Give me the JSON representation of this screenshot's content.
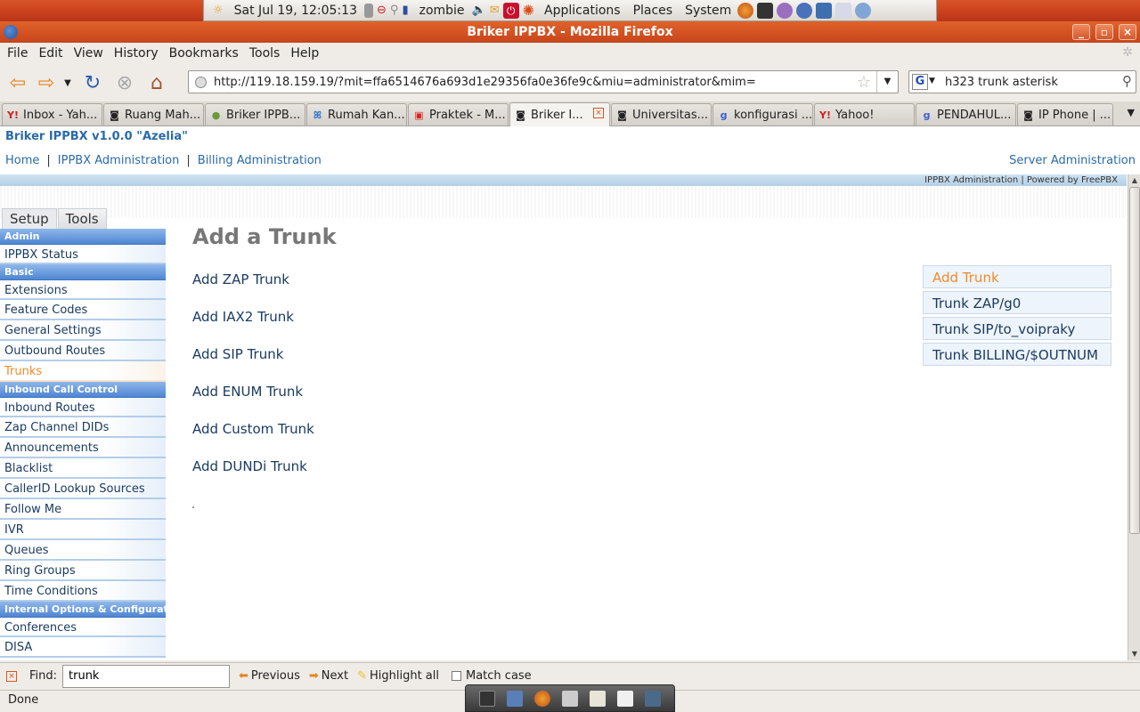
{
  "gnome_panel": {
    "clock": "Sat Jul 19, 12:05:13",
    "user": "zombie",
    "menus": [
      "Applications",
      "Places",
      "System"
    ]
  },
  "window": {
    "title": "Briker IPPBX - Mozilla Firefox"
  },
  "menubar": [
    "File",
    "Edit",
    "View",
    "History",
    "Bookmarks",
    "Tools",
    "Help"
  ],
  "navigation": {
    "url": "http://119.18.159.19/?mit=ffa6514676a693d1e29356fa0e36fe9c&miu=administrator&mim=",
    "search_query": "h323 trunk asterisk"
  },
  "tabs": [
    {
      "label": "Inbox - Yah...",
      "icon": "yahoo-icon"
    },
    {
      "label": "Ruang Mah...",
      "icon": "page-icon"
    },
    {
      "label": "Briker IPPB...",
      "icon": "page-icon"
    },
    {
      "label": "Rumah Kan...",
      "icon": "butterfly-icon"
    },
    {
      "label": "Praktek - M...",
      "icon": "page-icon"
    },
    {
      "label": "Briker I...",
      "icon": "page-icon",
      "active": true
    },
    {
      "label": "Universitas...",
      "icon": "page-icon"
    },
    {
      "label": "konfigurasi ...",
      "icon": "google-icon"
    },
    {
      "label": "Yahoo!",
      "icon": "yahoo-icon"
    },
    {
      "label": "PENDAHUL...",
      "icon": "google-icon"
    },
    {
      "label": "IP Phone | ...",
      "icon": "page-icon"
    }
  ],
  "page": {
    "brand": "Briker IPPBX v1.0.0 \"Azelia\"",
    "topnav": [
      "Home",
      "IPPBX Administration",
      "Billing Administration"
    ],
    "server_admin": "Server Administration",
    "powered_by": "IPPBX Administration | Powered by FreePBX",
    "side_tabs": [
      "Setup",
      "Tools"
    ],
    "sidebar": [
      {
        "type": "section",
        "label": "Admin"
      },
      {
        "type": "item",
        "label": "IPPBX Status"
      },
      {
        "type": "section",
        "label": "Basic"
      },
      {
        "type": "item",
        "label": "Extensions"
      },
      {
        "type": "item",
        "label": "Feature Codes"
      },
      {
        "type": "item",
        "label": "General Settings"
      },
      {
        "type": "item",
        "label": "Outbound Routes"
      },
      {
        "type": "item",
        "label": "Trunks",
        "active": true
      },
      {
        "type": "section",
        "label": "Inbound Call Control"
      },
      {
        "type": "item",
        "label": "Inbound Routes"
      },
      {
        "type": "item",
        "label": "Zap Channel DIDs"
      },
      {
        "type": "item",
        "label": "Announcements"
      },
      {
        "type": "item",
        "label": "Blacklist"
      },
      {
        "type": "item",
        "label": "CallerID Lookup Sources"
      },
      {
        "type": "item",
        "label": "Follow Me"
      },
      {
        "type": "item",
        "label": "IVR"
      },
      {
        "type": "item",
        "label": "Queues"
      },
      {
        "type": "item",
        "label": "Ring Groups"
      },
      {
        "type": "item",
        "label": "Time Conditions"
      },
      {
        "type": "section",
        "label": "Internal Options & Configuration"
      },
      {
        "type": "item",
        "label": "Conferences"
      },
      {
        "type": "item",
        "label": "DISA"
      }
    ],
    "main_title": "Add a Trunk",
    "add_links": [
      "Add ZAP Trunk",
      "Add IAX2 Trunk",
      "Add SIP Trunk",
      "Add ENUM Trunk",
      "Add Custom Trunk",
      "Add DUNDi Trunk"
    ],
    "trunk_list": [
      "Add Trunk",
      "Trunk ZAP/g0",
      "Trunk SIP/to_voipraky",
      "Trunk BILLING/$OUTNUM"
    ]
  },
  "findbar": {
    "label": "Find:",
    "value": "trunk",
    "previous": "Previous",
    "next": "Next",
    "highlight_all": "Highlight all",
    "match_case": "Match case"
  },
  "status": "Done",
  "colors": {
    "panel_orange": "#c9401b",
    "link_blue": "#2a6aa8",
    "active_orange": "#f08b2a",
    "section_blue": "#4f86d2"
  }
}
